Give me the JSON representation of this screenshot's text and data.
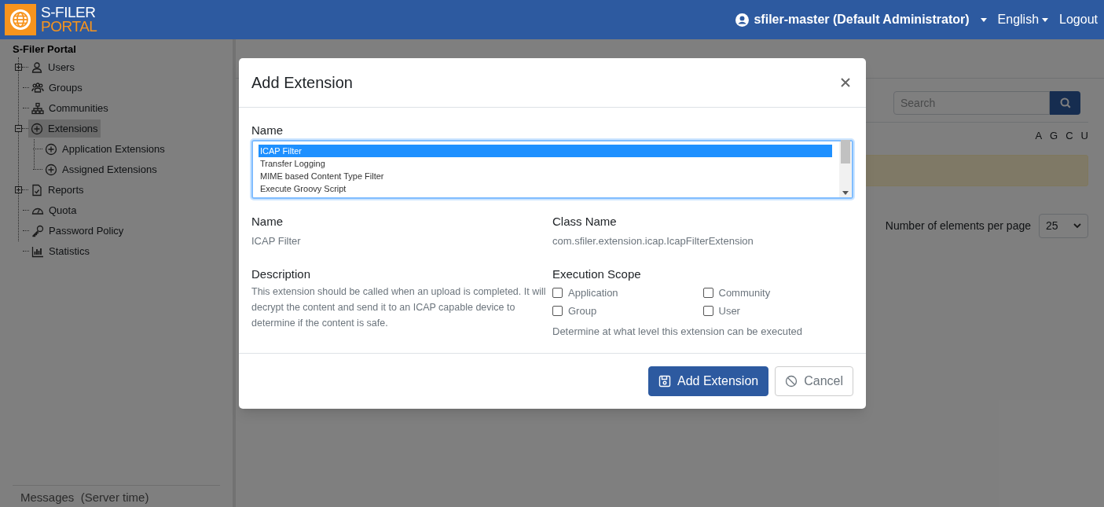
{
  "header": {
    "logo_top": "S-FILER",
    "logo_bottom": "PORTAL",
    "user": "sfiler-master (Default Administrator)",
    "language": "English",
    "logout": "Logout"
  },
  "sidebar": {
    "title": "S-Filer Portal",
    "items": [
      {
        "label": "Users",
        "expanded": false,
        "selected": false
      },
      {
        "label": "Groups",
        "selected": false
      },
      {
        "label": "Communities",
        "selected": false
      },
      {
        "label": "Extensions",
        "expanded": true,
        "selected": true,
        "children": [
          {
            "label": "Application Extensions",
            "selected": false
          },
          {
            "label": "Assigned Extensions",
            "selected": false
          }
        ]
      },
      {
        "label": "Reports",
        "expanded": false,
        "selected": false
      },
      {
        "label": "Quota",
        "selected": false
      },
      {
        "label": "Password Policy",
        "selected": false
      },
      {
        "label": "Statistics",
        "selected": false
      }
    ],
    "messages_title": "Messages  (Server time)"
  },
  "main": {
    "search": {
      "placeholder": "Search"
    },
    "letters": [
      "A",
      "G",
      "C",
      "U"
    ],
    "per_page": {
      "label": "Number of elements per page",
      "value": "25"
    }
  },
  "dialog": {
    "title": "Add Extension",
    "list_label": "Name",
    "options": [
      {
        "label": "ICAP Filter",
        "selected": true
      },
      {
        "label": "Transfer Logging",
        "selected": false
      },
      {
        "label": "MIME based Content Type Filter",
        "selected": false
      },
      {
        "label": "Execute Groovy Script",
        "selected": false
      }
    ],
    "name_label": "Name",
    "name_value": "ICAP Filter",
    "class_label": "Class Name",
    "class_value": "com.sfiler.extension.icap.IcapFilterExtension",
    "description_label": "Description",
    "description": "This extension should be called when an upload is completed. It will decrypt the content and send it to an ICAP capable device to determine if the content is safe.",
    "scope_label": "Execution Scope",
    "scopes": [
      {
        "label": "Application",
        "checked": false
      },
      {
        "label": "Community",
        "checked": false
      },
      {
        "label": "Group",
        "checked": false
      },
      {
        "label": "User",
        "checked": false
      }
    ],
    "scope_hint": "Determine at what level this extension can be executed",
    "buttons": [
      {
        "label": "Add Extension",
        "kind": "primary"
      },
      {
        "label": "Cancel",
        "kind": "secondary"
      }
    ]
  }
}
